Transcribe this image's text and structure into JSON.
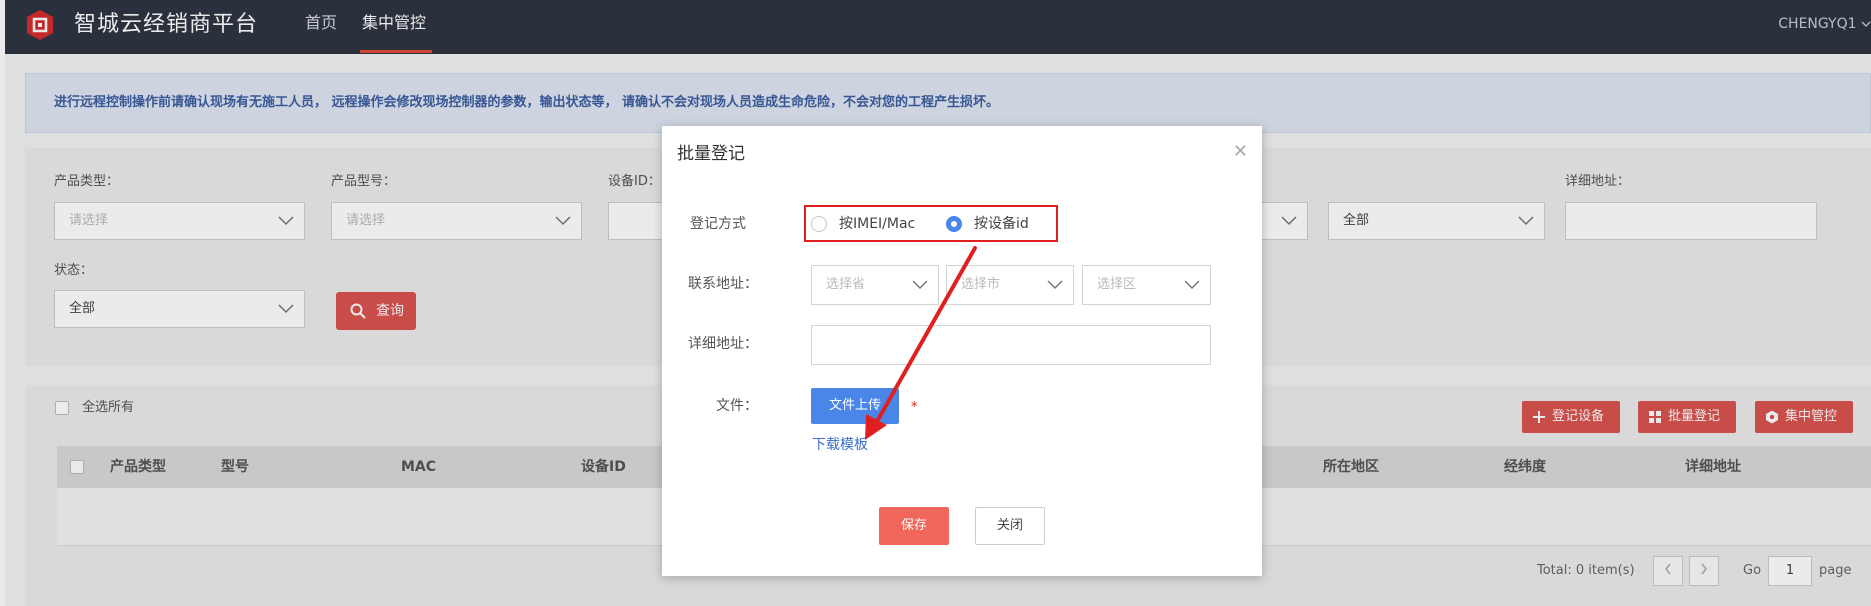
{
  "header": {
    "brand": "智城云经销商平台",
    "nav": [
      {
        "label": "首页",
        "active": false
      },
      {
        "label": "集中管控",
        "active": true
      }
    ],
    "user": "CHENGYQ1"
  },
  "notice": {
    "text": "进行远程控制操作前请确认现场有无施工人员， 远程操作会修改现场控制器的参数，输出状态等， 请确认不会对现场人员造成生命危险，不会对您的工程产生损坏。"
  },
  "filters": {
    "product_type": {
      "label": "产品类型：",
      "value": "请选择"
    },
    "product_model": {
      "label": "产品型号：",
      "value": "请选择"
    },
    "device_id": {
      "label": "设备ID："
    },
    "fourth_select": {
      "value": "全部"
    },
    "detail_address": {
      "label": "详细地址："
    },
    "status": {
      "label": "状态：",
      "value": "全部"
    },
    "query_label": "查询"
  },
  "list": {
    "select_all": "全选所有",
    "actions": [
      {
        "label": "登记设备",
        "icon": "plus-icon"
      },
      {
        "label": "批量登记",
        "icon": "grid-icon"
      },
      {
        "label": "集中管控",
        "icon": "hex-icon"
      }
    ],
    "columns": [
      "产品类型",
      "型号",
      "MAC",
      "设备ID",
      "所在地区",
      "经纬度",
      "详细地址"
    ],
    "rows": [],
    "pagination": {
      "total": "Total: 0 item(s)",
      "go": "Go",
      "page_value": "1",
      "page_word": "page"
    }
  },
  "modal": {
    "title": "批量登记",
    "register_mode": {
      "label": "登记方式",
      "options": [
        {
          "label": "按IMEI/Mac",
          "selected": false
        },
        {
          "label": "按设备id",
          "selected": true
        }
      ]
    },
    "contact_address": {
      "label": "联系地址：",
      "province": "选择省",
      "city": "选择市",
      "district": "选择区"
    },
    "detail_address": {
      "label": "详细地址：",
      "value": ""
    },
    "file": {
      "label": "文件：",
      "upload_label": "文件上传",
      "required_mark": "*"
    },
    "download_template": "下载模板",
    "save_label": "保存",
    "close_label": "关闭"
  },
  "colors": {
    "header_bg": "#2f3543",
    "accent_red": "#d9534f",
    "primary_blue": "#4a86e8",
    "annotation_red": "#e02020"
  }
}
